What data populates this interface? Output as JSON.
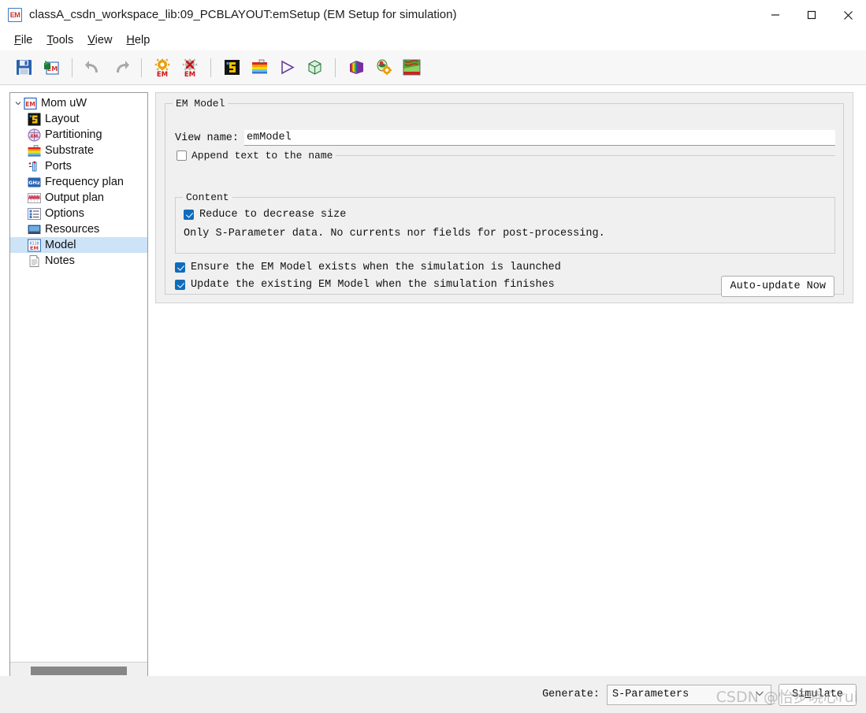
{
  "window": {
    "title": "classA_csdn_workspace_lib:09_PCBLAYOUT:emSetup (EM Setup for simulation)",
    "app_icon_label": "EM",
    "controls": {
      "minimize": "minimize-icon",
      "maximize": "maximize-icon",
      "close": "close-icon"
    }
  },
  "menubar": {
    "items": [
      {
        "label": "File",
        "mnemonic": "F"
      },
      {
        "label": "Tools",
        "mnemonic": "T"
      },
      {
        "label": "View",
        "mnemonic": "V"
      },
      {
        "label": "Help",
        "mnemonic": "H"
      }
    ]
  },
  "toolbar": {
    "buttons": [
      {
        "name": "save-icon",
        "tooltip": "Save"
      },
      {
        "name": "save-em-setup-icon",
        "tooltip": "Save EM Setup"
      },
      {
        "name": "undo-icon",
        "tooltip": "Undo"
      },
      {
        "name": "redo-icon",
        "tooltip": "Redo"
      },
      {
        "name": "em-simulate-icon",
        "tooltip": "Simulate"
      },
      {
        "name": "em-stop-icon",
        "tooltip": "Stop simulation"
      },
      {
        "name": "layout-icon",
        "tooltip": "Layout"
      },
      {
        "name": "substrate-icon",
        "tooltip": "Substrate"
      },
      {
        "name": "run-icon",
        "tooltip": "Run"
      },
      {
        "name": "mesh-cube-icon",
        "tooltip": "3D Mesh"
      },
      {
        "name": "rainbow-cube-icon",
        "tooltip": "3D View"
      },
      {
        "name": "em-options-icon",
        "tooltip": "EM Options"
      },
      {
        "name": "em-results-icon",
        "tooltip": "EM Results"
      }
    ]
  },
  "tree": {
    "root": {
      "label": "Mom uW",
      "icon": "em-icon",
      "expanded": true
    },
    "items": [
      {
        "label": "Layout",
        "icon": "layout-icon",
        "selected": false
      },
      {
        "label": "Partitioning",
        "icon": "partitioning-icon",
        "selected": false
      },
      {
        "label": "Substrate",
        "icon": "substrate-icon",
        "selected": false
      },
      {
        "label": "Ports",
        "icon": "ports-icon",
        "selected": false
      },
      {
        "label": "Frequency plan",
        "icon": "ghz-icon",
        "selected": false
      },
      {
        "label": "Output plan",
        "icon": "output-plan-icon",
        "selected": false
      },
      {
        "label": "Options",
        "icon": "options-icon",
        "selected": false
      },
      {
        "label": "Resources",
        "icon": "resources-icon",
        "selected": false
      },
      {
        "label": "Model",
        "icon": "model-icon",
        "selected": true
      },
      {
        "label": "Notes",
        "icon": "notes-icon",
        "selected": false
      }
    ]
  },
  "panel": {
    "em_model_group_title": "EM Model",
    "view_name_label": "View name:",
    "view_name_value": "emModel",
    "append_group_title": "Append text to the name",
    "append_checked": false,
    "content_group_title": "Content",
    "reduce_label": "Reduce to decrease size",
    "reduce_checked": true,
    "reduce_note": "Only S-Parameter data. No currents nor fields for post-processing.",
    "ensure_label": "Ensure the EM Model exists when the simulation is launched",
    "ensure_checked": true,
    "update_label": "Update the existing EM Model when the simulation finishes",
    "update_checked": true,
    "auto_update_button": "Auto-update Now"
  },
  "bottom": {
    "generate_label": "Generate:",
    "generate_value": "S-Parameters",
    "generate_options": [
      "S-Parameters"
    ],
    "simulate_button": "Simulate",
    "simulate_mnemonic": "m"
  },
  "watermark": {
    "text": "CSDN @怡步晓心rui"
  },
  "colors": {
    "accent": "#0f6cbd",
    "selection": "#cde3f7",
    "panel_bg": "#f0f0f0",
    "window_bg": "#ffffff"
  }
}
